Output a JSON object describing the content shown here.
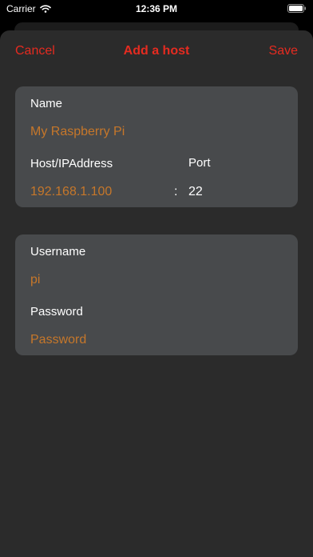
{
  "status_bar": {
    "carrier": "Carrier",
    "time": "12:36 PM",
    "wifi_icon": "wifi-icon",
    "battery_icon": "battery-icon"
  },
  "nav": {
    "cancel_label": "Cancel",
    "title": "Add a host",
    "save_label": "Save"
  },
  "host_section": {
    "name_label": "Name",
    "name_placeholder": "My Raspberry Pi",
    "host_label": "Host/IPAddress",
    "host_placeholder": "192.168.1.100",
    "separator": ":",
    "port_label": "Port",
    "port_value": "22"
  },
  "auth_section": {
    "username_label": "Username",
    "username_placeholder": "pi",
    "password_label": "Password",
    "password_placeholder": "Password"
  },
  "colors": {
    "accent": "#e52b20",
    "placeholder": "#c6772a",
    "card_background": "#484a4c",
    "sheet_background": "#2b2b2b"
  }
}
